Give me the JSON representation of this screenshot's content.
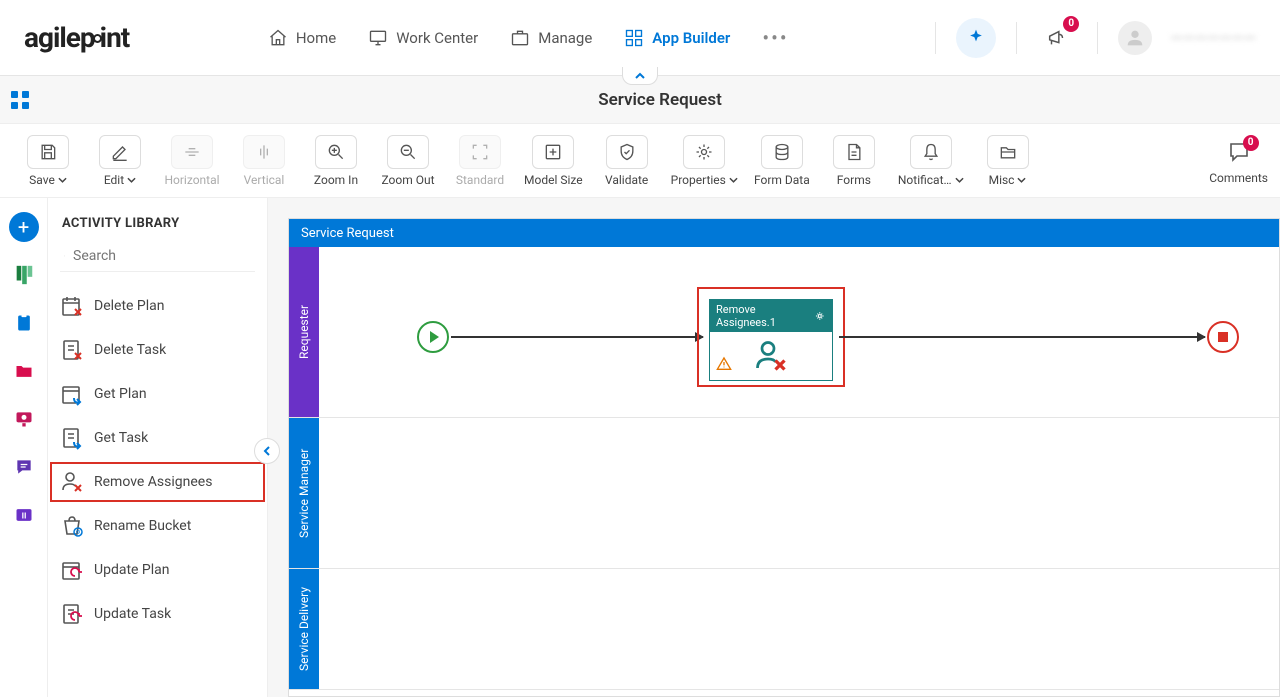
{
  "brand": "agilepoint",
  "nav": {
    "items": [
      {
        "label": "Home"
      },
      {
        "label": "Work Center"
      },
      {
        "label": "Manage"
      },
      {
        "label": "App Builder"
      }
    ],
    "notification_count": "0",
    "username": "———————"
  },
  "page_title": "Service Request",
  "toolbar": {
    "save": "Save",
    "edit": "Edit",
    "horizontal": "Horizontal",
    "vertical": "Vertical",
    "zoom_in": "Zoom In",
    "zoom_out": "Zoom Out",
    "standard": "Standard",
    "model_size": "Model Size",
    "validate": "Validate",
    "properties": "Properties",
    "form_data": "Form Data",
    "forms": "Forms",
    "notifications": "Notificat…",
    "misc": "Misc",
    "comments": "Comments",
    "comments_count": "0"
  },
  "library": {
    "header": "ACTIVITY LIBRARY",
    "search_placeholder": "Search",
    "items": [
      {
        "label": "Delete Plan"
      },
      {
        "label": "Delete Task"
      },
      {
        "label": "Get Plan"
      },
      {
        "label": "Get Task"
      },
      {
        "label": "Remove Assignees"
      },
      {
        "label": "Rename Bucket"
      },
      {
        "label": "Update Plan"
      },
      {
        "label": "Update Task"
      }
    ]
  },
  "canvas": {
    "title": "Service Request",
    "lanes": [
      {
        "label": "Requester"
      },
      {
        "label": "Service Manager"
      },
      {
        "label": "Service Delivery"
      }
    ],
    "activity_title": "Remove Assignees.1"
  }
}
